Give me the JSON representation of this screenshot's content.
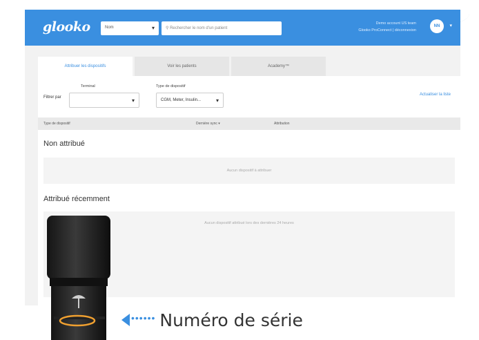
{
  "header": {
    "logo": "glooko",
    "select_value": "Nom",
    "search_placeholder": "Rechercher le nom d'un patient",
    "account_line1": "Demo account US team",
    "account_line2": "Glooko ProConnect | déconnexion",
    "avatar_initials": "NN"
  },
  "tabs": [
    {
      "label": "Attribuer les dispositifs",
      "active": true
    },
    {
      "label": "Voir les patients",
      "active": false
    },
    {
      "label": "Academy™",
      "active": false
    }
  ],
  "filters": {
    "filter_by_label": "Filtrer par",
    "terminal_label": "Terminal",
    "terminal_value": "",
    "device_type_label": "Type de dispositif",
    "device_type_value": "CGM, Meter, Insulin...",
    "refresh_link": "Actualiser la liste"
  },
  "table": {
    "col_device_type": "Type de dispositif",
    "col_last_sync": "Dernière sync ▾",
    "col_attribution": "Attribution"
  },
  "sections": {
    "unassigned_title": "Non attribué",
    "unassigned_empty": "Aucun dispositif à attribuer",
    "recent_title": "Attribué récemment",
    "recent_empty": "Aucun dispositif attribué lors des dernières 24 heures"
  },
  "callout": {
    "serial_label": "Numéro de série",
    "dots": "••••••"
  },
  "colors": {
    "brand_blue": "#3a8fe0",
    "highlight_orange": "#f0a030"
  },
  "icons": {
    "dropdown": "chevron-down-icon",
    "search": "search-icon",
    "pointer": "arrow-left-icon"
  }
}
